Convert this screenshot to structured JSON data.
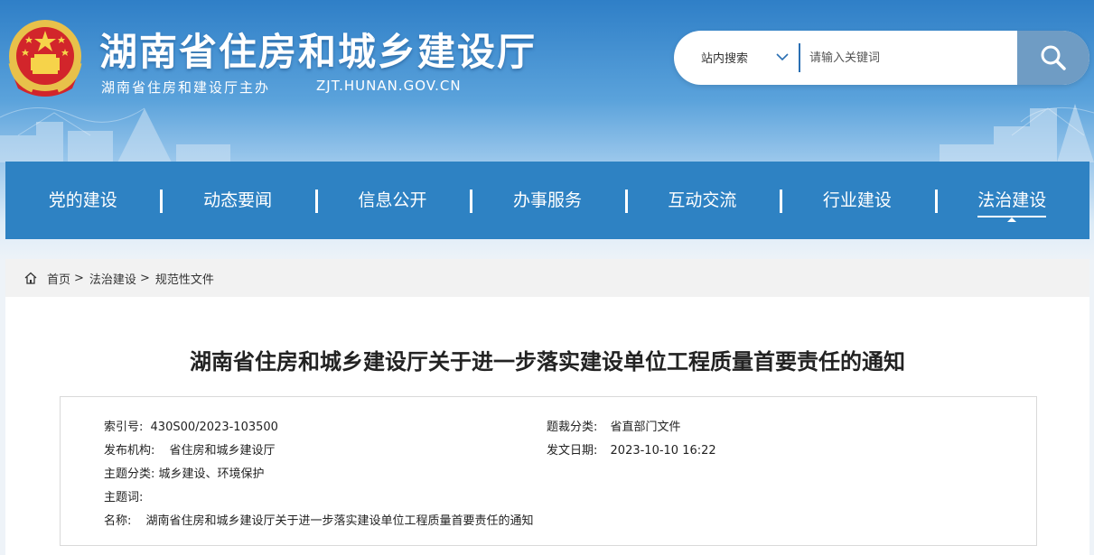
{
  "header": {
    "site_title": "湖南省住房和城乡建设厅",
    "sponsor": "湖南省住房和建设厅主办",
    "domain": "ZJT.HUNAN.GOV.CN"
  },
  "search": {
    "scope": "站内搜索",
    "placeholder": "请输入关键词",
    "button_icon": "search-icon"
  },
  "nav": {
    "items": [
      {
        "label": "党的建设"
      },
      {
        "label": "动态要闻"
      },
      {
        "label": "信息公开"
      },
      {
        "label": "办事服务"
      },
      {
        "label": "互动交流"
      },
      {
        "label": "行业建设"
      },
      {
        "label": "法治建设",
        "active": true
      }
    ]
  },
  "breadcrumb": {
    "home_icon": "home-icon",
    "items": [
      "首页",
      "法治建设",
      "规范性文件"
    ],
    "separator": ">"
  },
  "article": {
    "title": "湖南省住房和城乡建设厅关于进一步落实建设单位工程质量首要责任的通知",
    "meta": {
      "index_label": "索引号:",
      "index_value": "430S00/2023-103500",
      "genre_label": "题裁分类:",
      "genre_value": "省直部门文件",
      "issuer_label": "发布机构:",
      "issuer_value": "省住房和城乡建设厅",
      "date_label": "发文日期:",
      "date_value": "2023-10-10 16:22",
      "topic_label": "主题分类:",
      "topic_value": "城乡建设、环境保护",
      "keywords_label": "主题词:",
      "keywords_value": "",
      "name_label": "名称:",
      "name_value": "湖南省住房和城乡建设厅关于进一步落实建设单位工程质量首要责任的通知"
    }
  },
  "colors": {
    "nav_bg": "#2e82c3",
    "banner_top": "#2f7fc7",
    "search_button": "#6f9cc4"
  }
}
